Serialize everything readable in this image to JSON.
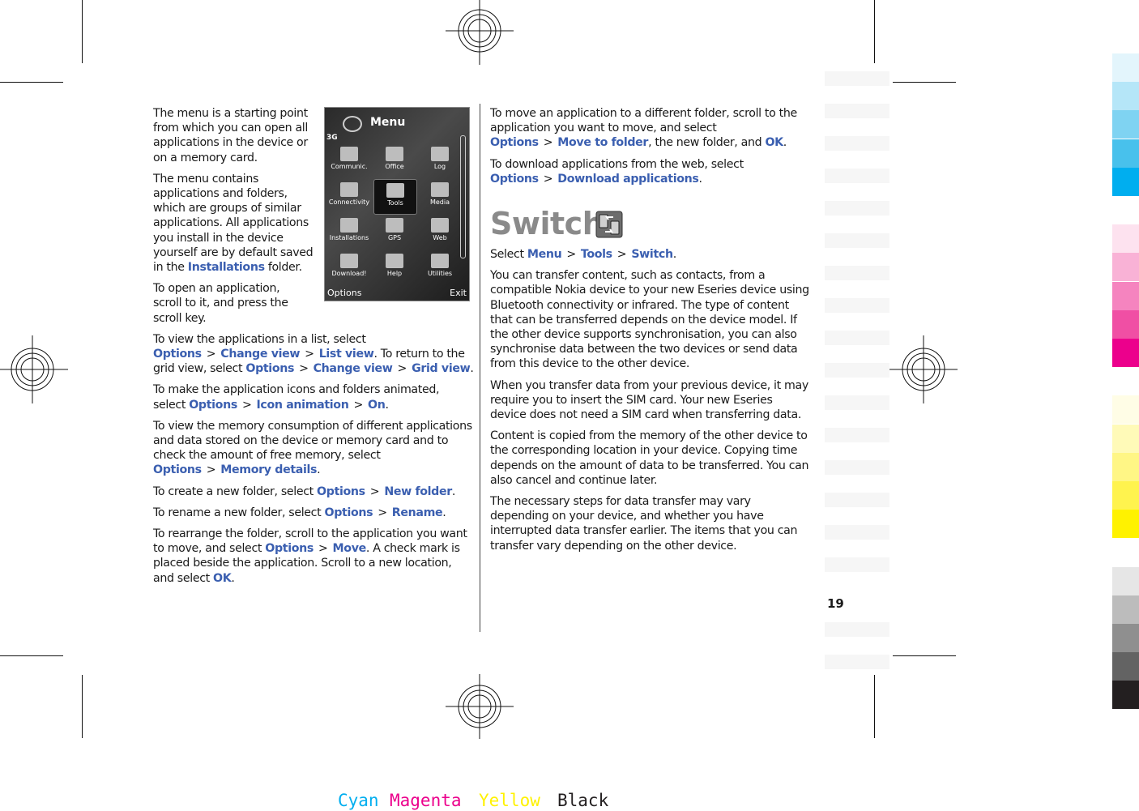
{
  "page_number": "19",
  "left_column": {
    "intro_p1": "The menu is a starting point from which you can open all applications in the device or on a memory card.",
    "intro_p2_pre": "The menu contains applications and folders, which are groups of similar applications. All applications you install in the device yourself are by default saved in the ",
    "intro_p2_link": "Installations",
    "intro_p2_post": " folder.",
    "open_app": "To open an application, scroll to it, and press the scroll key.",
    "list_view": {
      "pre": "To view the applications in a list, select ",
      "opt": "Options",
      "a": "Change view",
      "b": "List view",
      "mid": ". To return to the grid view, select ",
      "opt2": "Options",
      "c": "Change view",
      "d": "Grid view",
      "end": "."
    },
    "animate": {
      "pre": "To make the application icons and folders animated, select ",
      "opt": "Options",
      "a": "Icon animation",
      "b": "On",
      "end": "."
    },
    "memory": {
      "pre": "To view the memory consumption of different applications and data stored on the device or memory card and to check the amount of free memory, select ",
      "opt": "Options",
      "a": "Memory details",
      "end": "."
    },
    "new_folder": {
      "pre": "To create a new folder, select ",
      "opt": "Options",
      "a": "New folder",
      "end": "."
    },
    "rename": {
      "pre": "To rename a new folder, select ",
      "opt": "Options",
      "a": "Rename",
      "end": "."
    },
    "rearrange": {
      "pre": "To rearrange the folder, scroll to the application you want to move, and select ",
      "opt": "Options",
      "a": "Move",
      "mid": ". A check mark is placed beside the application. Scroll to a new location, and select ",
      "ok": "OK",
      "end": "."
    }
  },
  "phone_screen": {
    "title": "Menu",
    "network": "3G",
    "items": [
      "Communic.",
      "Office",
      "Log",
      "Connectivity",
      "Tools",
      "Media",
      "Installations",
      "GPS",
      "Web",
      "Download!",
      "Help",
      "Utilities"
    ],
    "selected": "Tools",
    "left_softkey": "Options",
    "right_softkey": "Exit"
  },
  "right_column": {
    "move": {
      "pre": "To move an application to a different folder, scroll to the application you want to move, and select ",
      "opt": "Options",
      "a": "Move to folder",
      "mid": ", the new folder, and ",
      "ok": "OK",
      "end": "."
    },
    "download": {
      "pre": "To download applications from the web, select ",
      "opt": "Options",
      "a": "Download applications",
      "end": "."
    },
    "heading": "Switch",
    "heading_icon": "switch-phones-icon",
    "select": {
      "pre": "Select ",
      "a": "Menu",
      "b": "Tools",
      "c": "Switch",
      "end": "."
    },
    "p1": "You can transfer content, such as contacts, from a compatible Nokia device to your new Eseries device using Bluetooth connectivity or infrared. The type of content that can be transferred depends on the device model. If the other device supports synchronisation, you can also synchronise data between the two devices or send data from this device to the other device.",
    "p2": "When you transfer data from your previous device, it may require you to insert the SIM card. Your new Eseries device does not need a SIM card when transferring data.",
    "p3": "Content is copied from the memory of the other device to the corresponding location in your device. Copying time depends on the amount of data to be transferred. You can also cancel and continue later.",
    "p4": "The necessary steps for data transfer may vary depending on your device, and whether you have interrupted data transfer earlier. The items that you can transfer vary depending on the other device."
  },
  "separator": ">",
  "color_bar": [
    "#e3f5fc",
    "#b5e6f8",
    "#7fd3f2",
    "#48c1ec",
    "#00aeef",
    "#ffffff",
    "#fde2ef",
    "#f9b2d6",
    "#f584bf",
    "#f04fa4",
    "#ec008c",
    "#ffffff",
    "#fffde6",
    "#fffab8",
    "#fff685",
    "#fff34e",
    "#fff200",
    "#ffffff",
    "#e6e6e6",
    "#bcbcbc",
    "#8f8f8f",
    "#636363",
    "#231f20"
  ],
  "cmyk_labels": [
    {
      "text": "Cyan",
      "color": "#00aeef"
    },
    {
      "text": "Magenta",
      "color": "#ec008c"
    },
    {
      "text": "Yellow",
      "color": "#fff200"
    },
    {
      "text": "Black",
      "color": "#231f20"
    }
  ]
}
